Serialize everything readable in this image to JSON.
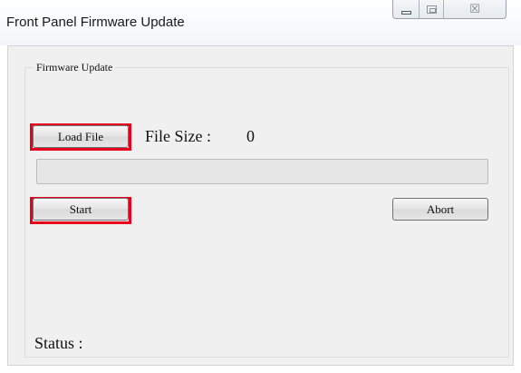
{
  "window": {
    "title": "Front Panel Firmware Update",
    "caption_icons": {
      "minimize": "minimize-icon",
      "maximize": "maximize-icon",
      "close": "close-icon",
      "close_glyph": "☒"
    }
  },
  "firmware_group": {
    "label": "Firmware Update",
    "load_file_label": "Load File",
    "file_size_label": "File Size :",
    "file_size_value": "0",
    "progress_percent": 0,
    "start_label": "Start",
    "abort_label": "Abort"
  },
  "status": {
    "label": "Status :",
    "value": ""
  },
  "colors": {
    "highlight": "#e8001c",
    "panel_background": "#f0f0f0"
  }
}
